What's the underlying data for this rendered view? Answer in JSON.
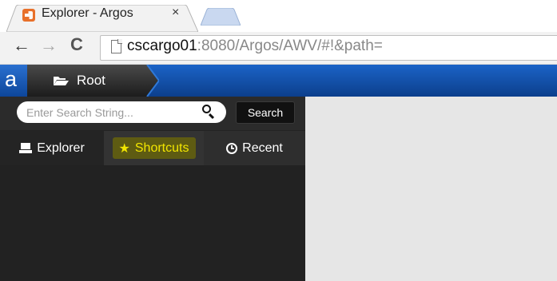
{
  "browser": {
    "tab_title": "Explorer - Argos",
    "tab_close": "×",
    "url_host": "cscargo01",
    "url_rest": ":8080/Argos/AWV/#!&path="
  },
  "app": {
    "logo": "a",
    "breadcrumb_label": "Root",
    "search": {
      "placeholder": "Enter Search String...",
      "button_label": "Search"
    },
    "tabs": [
      {
        "label": "Explorer",
        "icon": "drive-icon"
      },
      {
        "label": "Shortcuts",
        "icon": "star-icon"
      },
      {
        "label": "Recent",
        "icon": "clock-icon"
      }
    ]
  },
  "colors": {
    "app_bar": "#1b63c7",
    "panel": "#232323",
    "shortcut_text": "#f2e600",
    "content_bg": "#e6e6e6"
  }
}
